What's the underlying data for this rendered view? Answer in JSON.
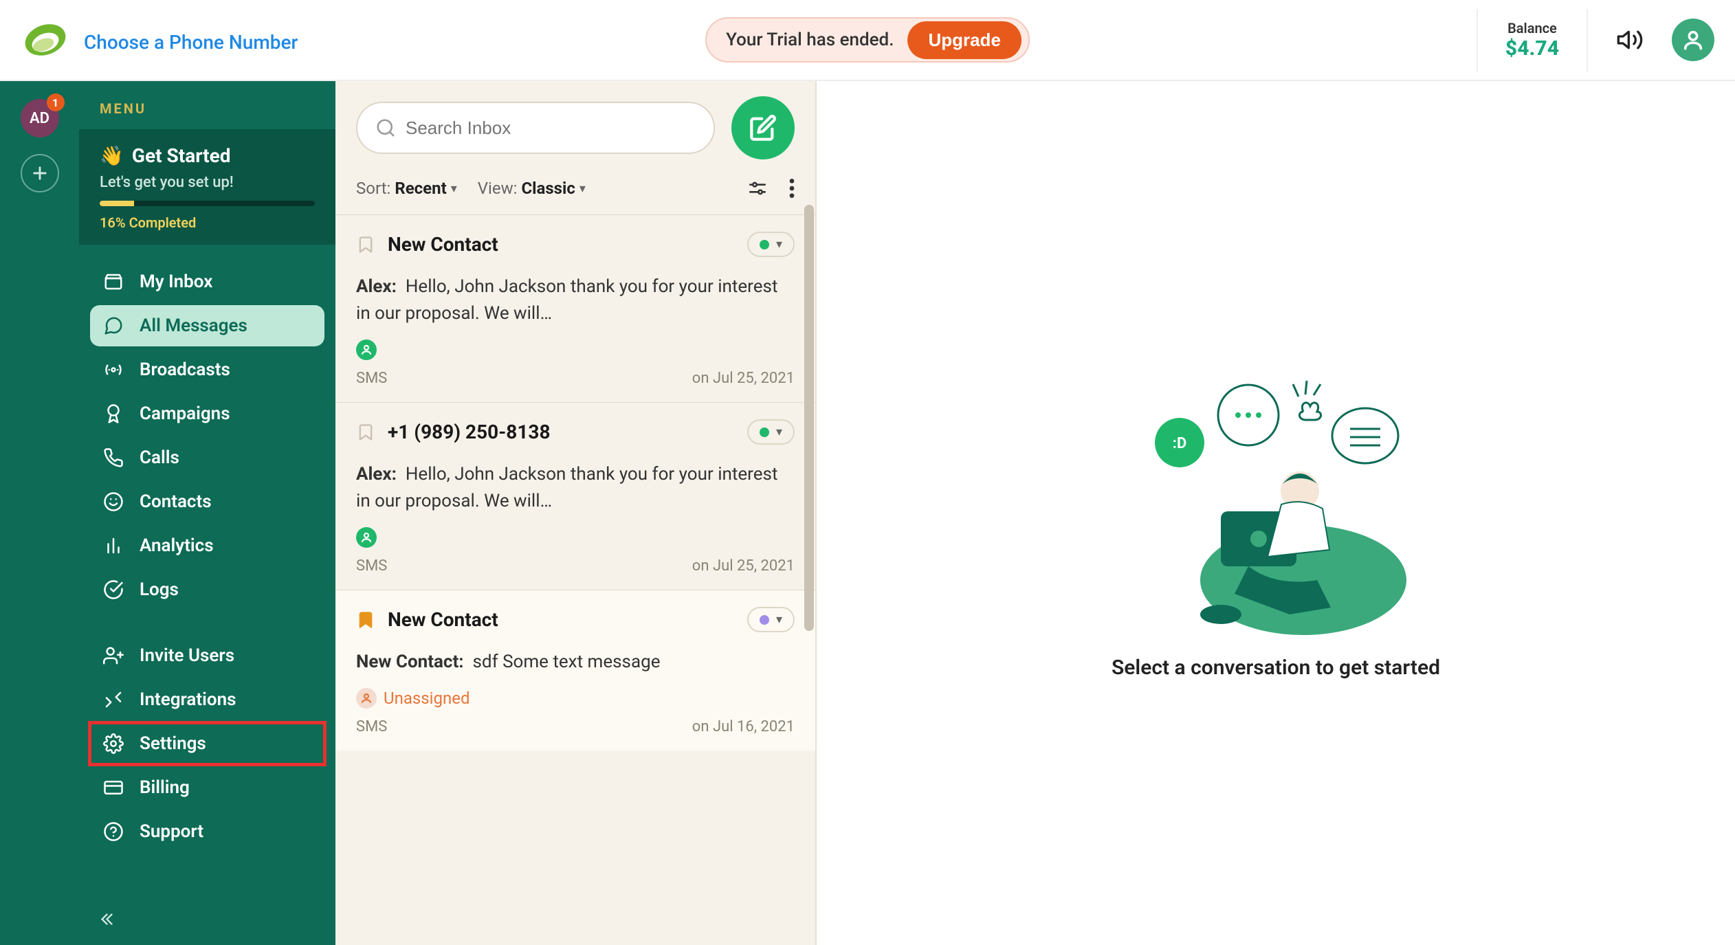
{
  "header": {
    "brand_name_blurred": "      ",
    "choose_phone": "Choose a Phone Number",
    "trial_text": "Your Trial has ended.",
    "upgrade_label": "Upgrade",
    "balance_label": "Balance",
    "balance_value": "$4.74"
  },
  "rail": {
    "avatar_initials": "AD",
    "avatar_badge": "1"
  },
  "sidebar": {
    "menu_label": "MENU",
    "getstarted": {
      "title": "Get Started",
      "subtitle": "Let's get you set up!",
      "progress_text": "16% Completed",
      "progress_pct": 16
    },
    "items": [
      {
        "label": "My Inbox",
        "icon": "inbox"
      },
      {
        "label": "All Messages",
        "icon": "chat",
        "active": true
      },
      {
        "label": "Broadcasts",
        "icon": "broadcast"
      },
      {
        "label": "Campaigns",
        "icon": "award"
      },
      {
        "label": "Calls",
        "icon": "phone"
      },
      {
        "label": "Contacts",
        "icon": "face"
      },
      {
        "label": "Analytics",
        "icon": "bars"
      },
      {
        "label": "Logs",
        "icon": "check-circle"
      }
    ],
    "items2": [
      {
        "label": "Invite Users",
        "icon": "user-plus"
      },
      {
        "label": "Integrations",
        "icon": "arrows"
      },
      {
        "label": "Settings",
        "icon": "gear",
        "highlighted": true
      },
      {
        "label": "Billing",
        "icon": "card"
      },
      {
        "label": "Support",
        "icon": "help"
      }
    ]
  },
  "inbox": {
    "search_placeholder": "Search Inbox",
    "sort_label": "Sort:",
    "sort_value": "Recent",
    "view_label": "View:",
    "view_value": "Classic",
    "threads": [
      {
        "title": "New Contact",
        "sender": "Alex:",
        "body": "Hello, John Jackson thank you for your interest in our proposal. We will…",
        "assignee": "             ",
        "assignee_type": "assigned",
        "channel": "SMS",
        "date": "on Jul 25, 2021",
        "status": "green",
        "bookmark": "off"
      },
      {
        "title": "+1 (989) 250-8138",
        "sender": "Alex:",
        "body": "Hello, John Jackson thank you for your interest in our proposal. We will…",
        "assignee": "             ",
        "assignee_type": "assigned",
        "channel": "SMS",
        "date": "on Jul 25, 2021",
        "status": "green",
        "bookmark": "off"
      },
      {
        "title": "New Contact",
        "sender": "New Contact:",
        "body": "sdf Some text message",
        "assignee": "Unassigned",
        "assignee_type": "unassigned",
        "channel": "SMS",
        "date": "on Jul 16, 2021",
        "status": "purple",
        "bookmark": "on"
      }
    ]
  },
  "main": {
    "empty_text": "Select a conversation to get started"
  }
}
